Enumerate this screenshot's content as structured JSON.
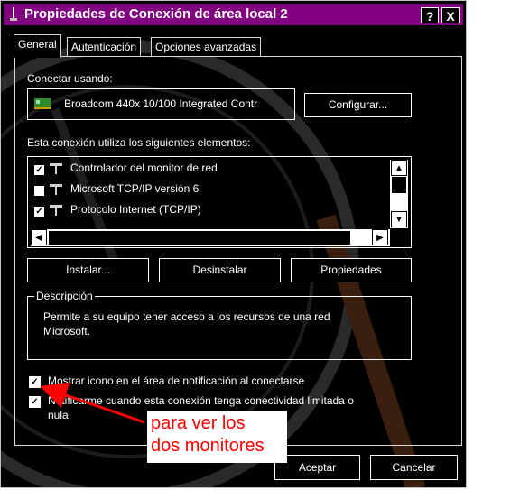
{
  "window": {
    "title": "Propiedades de Conexión de área local 2",
    "help_button": "?",
    "close_button": "X"
  },
  "tabs": [
    {
      "label": "General",
      "active": true
    },
    {
      "label": "Autenticación",
      "active": false
    },
    {
      "label": "Opciones avanzadas",
      "active": false
    }
  ],
  "connect": {
    "label": "Conectar usando:",
    "device": "Broadcom 440x 10/100 Integrated Contr",
    "configure_button": "Configurar..."
  },
  "components": {
    "label": "Esta conexión utiliza los siguientes elementos:",
    "items": [
      {
        "label": "Controlador del monitor de red",
        "checked": true
      },
      {
        "label": "Microsoft TCP/IP versión 6",
        "checked": false
      },
      {
        "label": "Protocolo Internet (TCP/IP)",
        "checked": true
      }
    ]
  },
  "buttons": {
    "install": "Instalar...",
    "uninstall": "Desinstalar",
    "properties": "Propiedades"
  },
  "description": {
    "legend": "Descripción",
    "text_line1": "Permite a su equipo tener acceso a los recursos de una red",
    "text_line2": "Microsoft."
  },
  "options": [
    {
      "label": "Mostrar icono en el área de notificación al conectarse",
      "checked": true
    },
    {
      "label_line1": "Notificarme cuando esta conexión tenga conectividad limitada o",
      "label_line2": "nula",
      "checked": true
    }
  ],
  "footer": {
    "ok": "Aceptar",
    "cancel": "Cancelar"
  },
  "annotation": {
    "line1": "para ver los",
    "line2": "dos monitores",
    "color": "#ff0000"
  },
  "colors": {
    "titlebar": "#800080",
    "background": "#000000",
    "text": "#ffffff"
  }
}
